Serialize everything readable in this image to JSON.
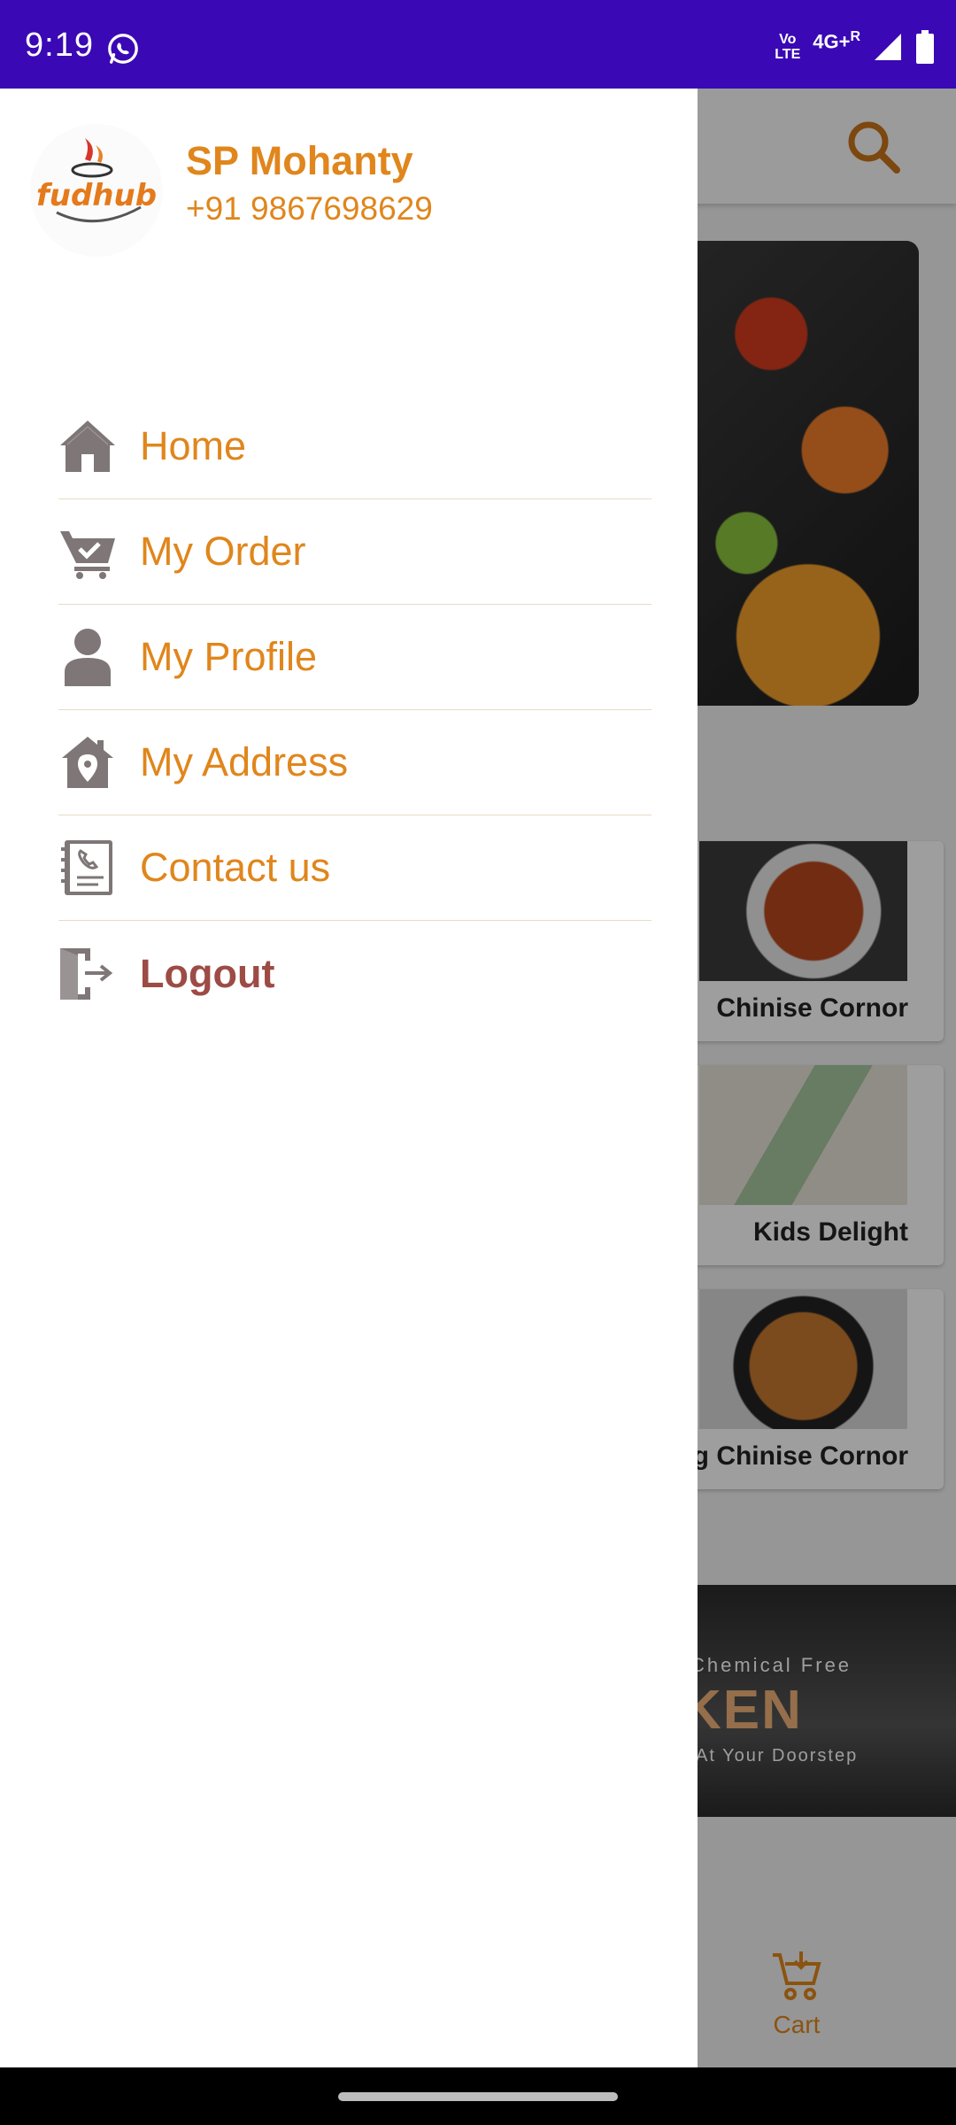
{
  "status_bar": {
    "time": "9:19",
    "volte_line1": "Vo",
    "volte_line2": "LTE",
    "network": "4G+",
    "roaming": "R",
    "whatsapp_icon": "whatsapp-icon",
    "signal_icon": "signal-icon",
    "battery_icon": "battery-icon"
  },
  "background_app": {
    "search_icon": "search-icon",
    "cards": [
      "Chinise Cornor",
      "Kids Delight",
      "g Chinise Cornor"
    ],
    "promo": {
      "line1": "Chemical Free",
      "line2": "KEN",
      "line3": "At Your Doorstep"
    },
    "cart_label": "Cart"
  },
  "drawer": {
    "logo_text": "fudhub",
    "user_name": "SP Mohanty",
    "user_phone": "+91 9867698629",
    "items": [
      {
        "label": "Home",
        "icon": "home-icon"
      },
      {
        "label": "My Order",
        "icon": "cart-check-icon"
      },
      {
        "label": "My Profile",
        "icon": "person-icon"
      },
      {
        "label": "My Address",
        "icon": "address-pin-icon"
      },
      {
        "label": "Contact us",
        "icon": "contact-book-icon"
      },
      {
        "label": "Logout",
        "icon": "logout-door-icon"
      }
    ]
  },
  "colors": {
    "status_bar": "#3a08b4",
    "accent": "#e0861c",
    "logout": "#9d4b45",
    "icon_gray": "#7e7677"
  }
}
